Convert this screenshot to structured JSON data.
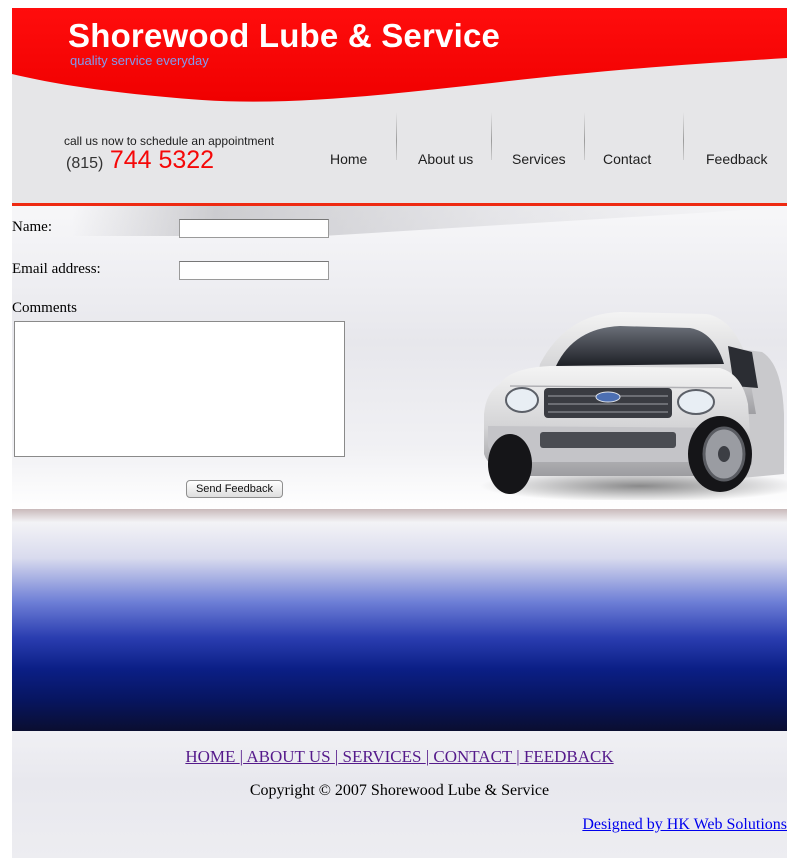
{
  "header": {
    "title": "Shorewood Lube & Service",
    "tagline": "quality service everyday",
    "call_text": "call us now to schedule an appointment",
    "phone_area": "(815)",
    "phone_number": "744 5322"
  },
  "nav": {
    "home": "Home",
    "about": "About us",
    "services": "Services",
    "contact": "Contact",
    "feedback": "Feedback"
  },
  "form": {
    "name_label": "Name:",
    "name_value": "",
    "email_label": "Email address:",
    "email_value": "",
    "comments_label": "Comments",
    "comments_value": "",
    "submit_label": "Send Feedback"
  },
  "footer": {
    "links": [
      {
        "label": "HOME "
      },
      {
        "label": " ABOUT US "
      },
      {
        "label": " SERVICES "
      },
      {
        "label": " CONTACT "
      },
      {
        "label": " FEEDBACK"
      }
    ],
    "separator": "|",
    "copyright": "Copyright © 2007 Shorewood Lube & Service",
    "designer": "Designed by HK Web Solutions"
  },
  "colors": {
    "brand_red": "#f50808",
    "tagline_blue": "#7f9cf0",
    "accent_line": "#ee2a12",
    "band_blue": "#0b1f86"
  }
}
